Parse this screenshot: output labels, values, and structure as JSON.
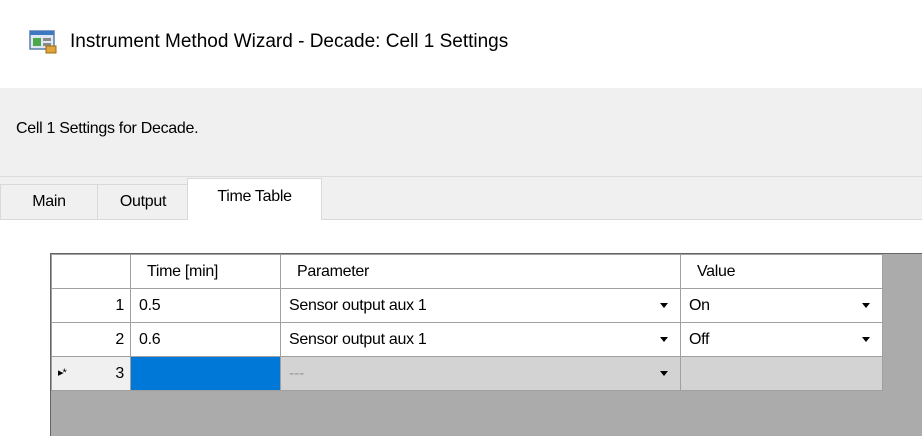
{
  "window": {
    "title": "Instrument Method Wizard - Decade: Cell 1 Settings"
  },
  "description": "Cell 1 Settings for Decade.",
  "tabs": [
    {
      "label": "Main"
    },
    {
      "label": "Output"
    },
    {
      "label": "Time Table",
      "active": true
    }
  ],
  "table": {
    "columns": [
      "",
      "Time [min]",
      "Parameter",
      "Value"
    ],
    "rows": [
      {
        "num": "1",
        "time": "0.5",
        "parameter": "Sensor output aux 1",
        "value": "On"
      },
      {
        "num": "2",
        "time": "0.6",
        "parameter": "Sensor output aux 1",
        "value": "Off"
      }
    ],
    "new_row": {
      "marker": "▸*",
      "num": "3",
      "parameter_placeholder": "---"
    }
  },
  "icons": {
    "title": "wizard-app-icon",
    "dropdown": "chevron-down-icon"
  },
  "colors": {
    "selection": "#0078d7",
    "grid_background": "#ababab",
    "new_row": "#d3d3d3"
  }
}
